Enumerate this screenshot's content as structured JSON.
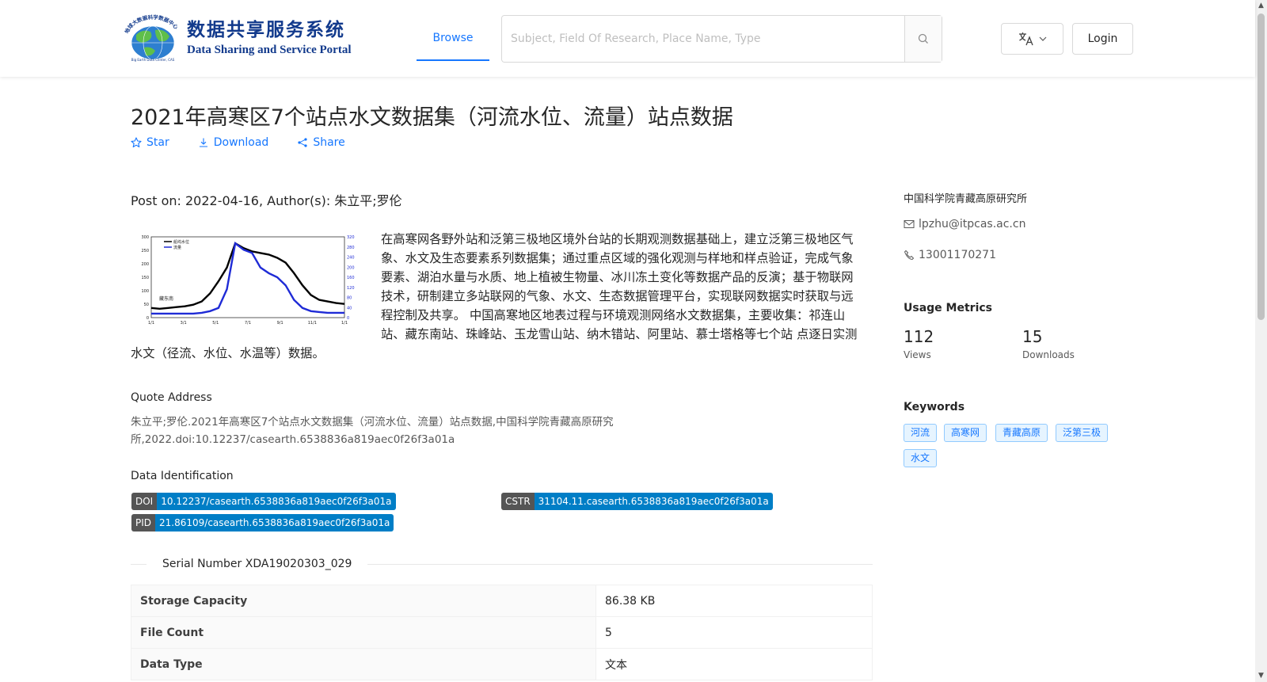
{
  "header": {
    "logo": {
      "title_cn": "数据共享服务系统",
      "title_en": "Data Sharing and Service Portal",
      "emblem_text": "地球大数据科学数据中心",
      "emblem_subtext": "Big Earth Data Center, CAS"
    },
    "nav": {
      "browse_label": "Browse"
    },
    "search": {
      "placeholder": "Subject, Field Of Research, Place Name, Type",
      "value": "",
      "icon": "search-icon"
    },
    "language": {
      "icon": "translate-icon"
    },
    "login_label": "Login"
  },
  "dataset": {
    "title": "2021年高寒区7个站点水文数据集（河流水位、流量）站点数据",
    "actions": [
      {
        "label": "Star",
        "icon": "star-icon"
      },
      {
        "label": "Download",
        "icon": "download-icon"
      },
      {
        "label": "Share",
        "icon": "share-icon"
      }
    ],
    "post_info": "Post on: 2022-04-16, Author(s): 朱立平;罗伦",
    "thumbnail": {
      "chart_data": {
        "type": "line",
        "legend": [
          "船坞水位",
          "流量"
        ],
        "station_label": "藏东南",
        "x_ticks": [
          "1/1",
          "3/1",
          "5/1",
          "7/1",
          "9/1",
          "11/1",
          "1/1"
        ],
        "y_ticks_left": [
          "0",
          "50",
          "100",
          "150",
          "200",
          "250",
          "300"
        ],
        "y_ticks_right": [
          "0",
          "40",
          "80",
          "120",
          "160",
          "200",
          "240",
          "280",
          "320"
        ],
        "colors": {
          "series1": "#000000",
          "series2": "#1f2bd6"
        }
      }
    },
    "abstract": "在高寒网各野外站和泛第三极地区境外台站的长期观测数据基础上，建立泛第三极地区气象、水文及生态要素系列数据集；通过重点区域的强化观测与样地和样点验证，完成气象要素、湖泊水量与水质、地上植被生物量、冰川冻土变化等数据产品的反演；基于物联网技术，研制建立多站联网的气象、水文、生态数据管理平台，实现联网数据实时获取与远程控制及共享。 中国高寒地区地表过程与环境观测网络水文数据集，主要收集：祁连山站、藏东南站、珠峰站、玉龙雪山站、纳木错站、阿里站、慕士塔格等七个站 点逐日实测水文（径流、水位、水温等）数据。",
    "quote_heading": "Quote Address",
    "quote": "朱立平;罗伦.2021年高寒区7个站点水文数据集（河流水位、流量）站点数据,中国科学院青藏高原研究所,2022.doi:10.12237/casearth.6538836a819aec0f26f3a01a",
    "identification_heading": "Data Identification",
    "identifiers": {
      "doi": {
        "label": "DOI",
        "value": "10.12237/casearth.6538836a819aec0f26f3a01a"
      },
      "cstr": {
        "label": "CSTR",
        "value": "31104.11.casearth.6538836a819aec0f26f3a01a"
      },
      "pid": {
        "label": "PID",
        "value": "21.86109/casearth.6538836a819aec0f26f3a01a"
      }
    },
    "serial_number": "Serial Number XDA19020303_029",
    "info_table": [
      {
        "key": "Storage Capacity",
        "value": "86.38 KB"
      },
      {
        "key": "File Count",
        "value": "5"
      },
      {
        "key": "Data Type",
        "value": "文本"
      }
    ]
  },
  "sidebar": {
    "organization": "中国科学院青藏高原研究所",
    "email": "lpzhu@itpcas.ac.cn",
    "phone": "13001170271",
    "metrics_heading": "Usage Metrics",
    "views": {
      "value": "112",
      "label": "Views"
    },
    "downloads": {
      "value": "15",
      "label": "Downloads"
    },
    "keywords_heading": "Keywords",
    "keywords": [
      "河流",
      "高寒网",
      "青藏高原",
      "泛第三极",
      "水文"
    ]
  },
  "colors": {
    "accent": "#1677ff",
    "badge_left": "#555555",
    "badge_right": "#007ec6"
  }
}
